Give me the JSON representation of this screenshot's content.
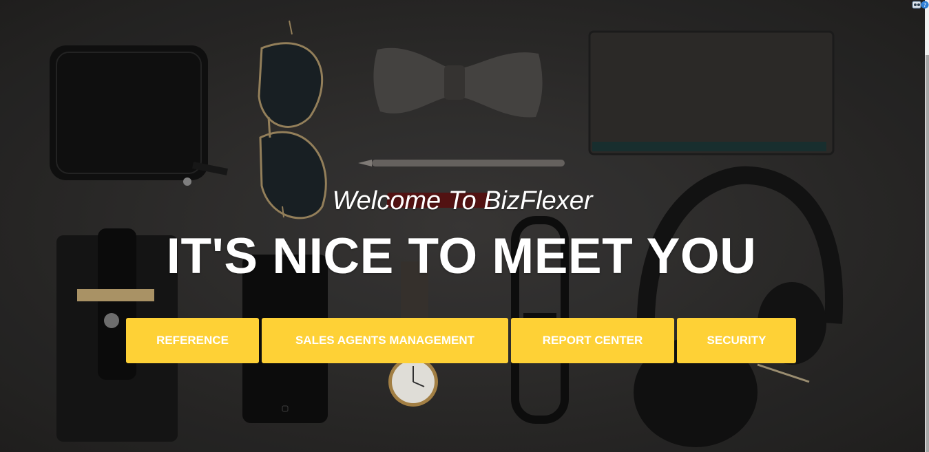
{
  "hero": {
    "subtitle": "Welcome To BizFlexer",
    "headline": "IT'S NICE TO MEET YOU",
    "background_color": "#2e2d2c"
  },
  "buttons": {
    "reference": "REFERENCE",
    "sales_agents": "SALES AGENTS MANAGEMENT",
    "report_center": "REPORT CENTER",
    "security": "SECURITY",
    "color": "#fed136",
    "text_color": "#ffffff"
  },
  "corner_icons": [
    "extension-icon",
    "help-icon"
  ]
}
